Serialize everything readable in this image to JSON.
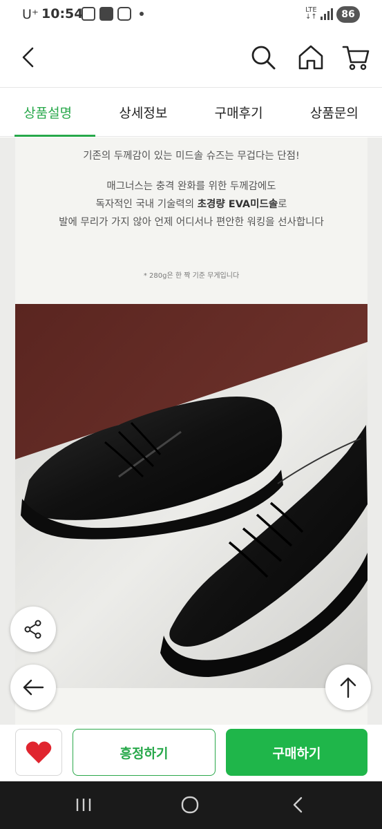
{
  "status_bar": {
    "carrier": "U⁺",
    "time": "10:54",
    "network": "LTE",
    "battery": "86"
  },
  "app_bar": {
    "icons": [
      "back-arrow-icon",
      "search-icon",
      "home-icon",
      "cart-icon"
    ]
  },
  "tabs": [
    {
      "label": "상품설명",
      "active": true
    },
    {
      "label": "상세정보",
      "active": false
    },
    {
      "label": "구매후기",
      "active": false
    },
    {
      "label": "상품문의",
      "active": false
    }
  ],
  "description": {
    "line1": "기존의 두께감이 있는 미드솔 슈즈는 무겁다는 단점!",
    "line2": "매그너스는 충격 완화를 위한 두께감에도",
    "line3_prefix": "독자적인 국내 기술력의 ",
    "line3_bold": "초경량 EVA미드솔",
    "line3_suffix": "로",
    "line4": "발에 무리가 가지 않아 언제 어디서나 편안한 워킹을 선사합니다",
    "note": "* 280g은 한 짝 기준 무게입니다"
  },
  "floating": {
    "share_icon": "share-icon",
    "back_icon": "arrow-left-icon",
    "top_icon": "arrow-up-icon"
  },
  "actions": {
    "like_icon": "heart-icon",
    "nego_label": "흥정하기",
    "buy_label": "구매하기"
  },
  "colors": {
    "accent_green": "#27a84a",
    "buy_button": "#1fb64a",
    "heart": "#e0252f"
  }
}
